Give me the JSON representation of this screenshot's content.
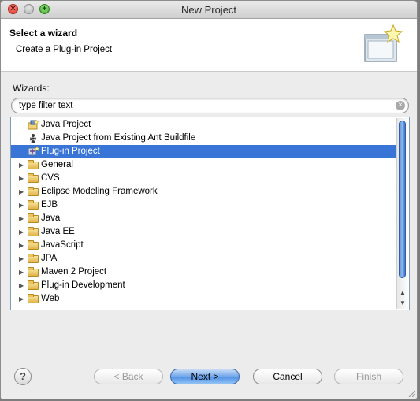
{
  "window": {
    "title": "New Project"
  },
  "header": {
    "title": "Select a wizard",
    "description": "Create a Plug-in Project"
  },
  "wizards_label": "Wizards:",
  "filter": {
    "value": "type filter text"
  },
  "tree": {
    "items": [
      {
        "label": "Java Project",
        "kind": "java-project-icon"
      },
      {
        "label": "Java Project from Existing Ant Buildfile",
        "kind": "ant-icon"
      },
      {
        "label": "Plug-in Project",
        "kind": "plugin-icon",
        "selected": true
      },
      {
        "label": "General",
        "kind": "folder"
      },
      {
        "label": "CVS",
        "kind": "folder"
      },
      {
        "label": "Eclipse Modeling Framework",
        "kind": "folder"
      },
      {
        "label": "EJB",
        "kind": "folder"
      },
      {
        "label": "Java",
        "kind": "folder"
      },
      {
        "label": "Java EE",
        "kind": "folder"
      },
      {
        "label": "JavaScript",
        "kind": "folder"
      },
      {
        "label": "JPA",
        "kind": "folder"
      },
      {
        "label": "Maven 2 Project",
        "kind": "folder"
      },
      {
        "label": "Plug-in Development",
        "kind": "folder"
      },
      {
        "label": "Web",
        "kind": "folder"
      }
    ]
  },
  "buttons": {
    "help": "?",
    "back": "< Back",
    "next": "Next >",
    "cancel": "Cancel",
    "finish": "Finish"
  },
  "colors": {
    "selection": "#3875d7",
    "default_button": "#4d8fe3"
  }
}
